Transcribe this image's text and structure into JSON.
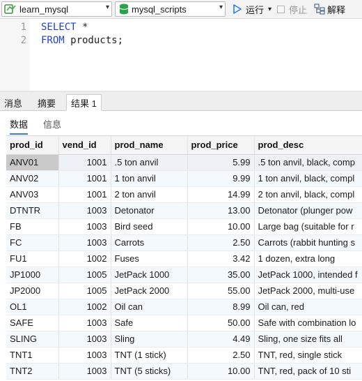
{
  "toolbar": {
    "connection": "learn_mysql",
    "database": "mysql_scripts",
    "run_label": "运行",
    "stop_label": "停止",
    "explain_label": "解释"
  },
  "editor": {
    "lines": [
      {
        "number": "1",
        "keyword": "SELECT",
        "rest": " *"
      },
      {
        "number": "2",
        "keyword": "FROM",
        "rest": " products;"
      }
    ]
  },
  "tabs": [
    {
      "label": "消息",
      "active": false
    },
    {
      "label": "摘要",
      "active": false
    },
    {
      "label": "结果 1",
      "active": true
    }
  ],
  "subtabs": [
    {
      "label": "数据",
      "active": true
    },
    {
      "label": "信息",
      "active": false
    }
  ],
  "grid": {
    "columns": [
      "prod_id",
      "vend_id",
      "prod_name",
      "prod_price",
      "prod_desc"
    ],
    "rows": [
      [
        "ANV01",
        "1001",
        ".5 ton anvil",
        "5.99",
        ".5 ton anvil, black, comp"
      ],
      [
        "ANV02",
        "1001",
        "1 ton anvil",
        "9.99",
        "1 ton anvil, black, compl"
      ],
      [
        "ANV03",
        "1001",
        "2 ton anvil",
        "14.99",
        "2 ton anvil, black, compl"
      ],
      [
        "DTNTR",
        "1003",
        "Detonator",
        "13.00",
        "Detonator (plunger pow"
      ],
      [
        "FB",
        "1003",
        "Bird seed",
        "10.00",
        "Large bag (suitable for r"
      ],
      [
        "FC",
        "1003",
        "Carrots",
        "2.50",
        "Carrots (rabbit hunting s"
      ],
      [
        "FU1",
        "1002",
        "Fuses",
        "3.42",
        "1 dozen, extra long"
      ],
      [
        "JP1000",
        "1005",
        "JetPack 1000",
        "35.00",
        "JetPack 1000, intended f"
      ],
      [
        "JP2000",
        "1005",
        "JetPack 2000",
        "55.00",
        "JetPack 2000, multi-use"
      ],
      [
        "OL1",
        "1002",
        "Oil can",
        "8.99",
        "Oil can, red"
      ],
      [
        "SAFE",
        "1003",
        "Safe",
        "50.00",
        "Safe with combination lo"
      ],
      [
        "SLING",
        "1003",
        "Sling",
        "4.49",
        "Sling, one size fits all"
      ],
      [
        "TNT1",
        "1003",
        "TNT (1 stick)",
        "2.50",
        "TNT, red, single stick"
      ],
      [
        "TNT2",
        "1003",
        "TNT (5 sticks)",
        "10.00",
        "TNT, red, pack of 10 sti"
      ]
    ]
  },
  "colors": {
    "keyword": "#2140c8",
    "run_icon": "#2f7fd8",
    "db_icon": "#2aa44a",
    "conn_icon": "#4caf50"
  }
}
